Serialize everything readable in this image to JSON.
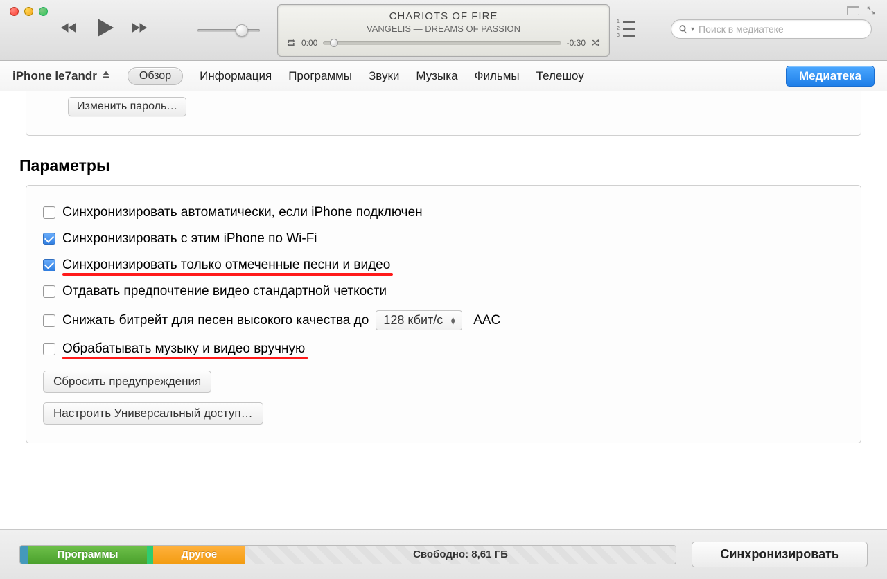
{
  "player": {
    "title": "CHARIOTS OF FIRE",
    "subtitle": "VANGELIS — DREAMS OF PASSION",
    "elapsed": "0:00",
    "remaining": "-0:30"
  },
  "search": {
    "placeholder": "Поиск в медиатеке"
  },
  "tabs": {
    "device": "iPhone le7andr",
    "active": "Обзор",
    "items": [
      "Информация",
      "Программы",
      "Звуки",
      "Музыка",
      "Фильмы",
      "Телешоу"
    ],
    "library": "Медиатека"
  },
  "password_section": {
    "change_password": "Изменить пароль…"
  },
  "params": {
    "title": "Параметры",
    "rows": [
      {
        "checked": false,
        "label": "Синхронизировать автоматически, если iPhone подключен",
        "redline": false
      },
      {
        "checked": true,
        "label": "Синхронизировать с этим iPhone по Wi-Fi",
        "redline": false
      },
      {
        "checked": true,
        "label": "Синхронизировать только отмеченные песни и видео",
        "redline": true
      },
      {
        "checked": false,
        "label": "Отдавать предпочтение видео стандартной четкости",
        "redline": false
      },
      {
        "checked": false,
        "label": "Снижать битрейт для песен высокого качества до",
        "redline": false,
        "has_select": true,
        "select": "128 кбит/с",
        "suffix": "AAC"
      },
      {
        "checked": false,
        "label": "Обрабатывать музыку и видео вручную",
        "redline": true
      }
    ],
    "reset_warnings": "Сбросить предупреждения",
    "universal_access": "Настроить Универсальный доступ…"
  },
  "bottom": {
    "apps": "Программы",
    "other": "Другое",
    "free": "Свободно: 8,61 ГБ",
    "sync": "Синхронизировать"
  }
}
